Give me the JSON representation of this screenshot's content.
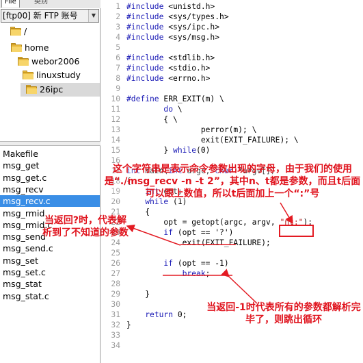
{
  "sidebar": {
    "tabs": [
      "File",
      "类别"
    ],
    "site_select": "[ftp00] 新 FTP 账号",
    "tree": [
      {
        "label": "/"
      },
      {
        "label": "home"
      },
      {
        "label": "webor2006"
      },
      {
        "label": "linuxstudy"
      },
      {
        "label": "26ipc",
        "selected": true
      }
    ],
    "files": [
      "Makefile",
      "msg_get",
      "msg_get.c",
      "msg_recv",
      "msg_recv.c",
      "msg_rmid",
      "msg_rmid.c",
      "msg_send",
      "msg_send.c",
      "msg_set",
      "msg_set.c",
      "msg_stat",
      "msg_stat.c"
    ],
    "selected_file": "msg_recv.c"
  },
  "editor": {
    "lines": [
      {
        "n": "1",
        "t": "#include <unistd.h>"
      },
      {
        "n": "2",
        "t": "#include <sys/types.h>"
      },
      {
        "n": "3",
        "t": "#include <sys/ipc.h>"
      },
      {
        "n": "4",
        "t": "#include <sys/msg.h>"
      },
      {
        "n": "5",
        "t": ""
      },
      {
        "n": "6",
        "t": "#include <stdlib.h>"
      },
      {
        "n": "7",
        "t": "#include <stdio.h>"
      },
      {
        "n": "8",
        "t": "#include <errno.h>"
      },
      {
        "n": "9",
        "t": ""
      },
      {
        "n": "10",
        "t": "#define ERR_EXIT(m) \\"
      },
      {
        "n": "11",
        "t": "        do \\"
      },
      {
        "n": "12",
        "t": "        { \\"
      },
      {
        "n": "13",
        "t": "                perror(m); \\"
      },
      {
        "n": "14",
        "t": "                exit(EXIT_FAILURE); \\"
      },
      {
        "n": "15",
        "t": "        } while(0)"
      },
      {
        "n": "16",
        "t": ""
      },
      {
        "n": "17",
        "t": "int main(int argc, char *argv[])"
      },
      {
        "n": "18",
        "t": "{"
      },
      {
        "n": "19",
        "t": "    int opt;"
      },
      {
        "n": "20",
        "t": "    while (1)"
      },
      {
        "n": "21",
        "t": "    {"
      },
      {
        "n": "22",
        "t": "        opt = getopt(argc, argv, \"nt:\");"
      },
      {
        "n": "23",
        "t": "        if (opt == '?')"
      },
      {
        "n": "24",
        "t": "            exit(EXIT_FAILURE);"
      },
      {
        "n": "25",
        "t": ""
      },
      {
        "n": "26",
        "t": "        if (opt == -1)"
      },
      {
        "n": "27",
        "t": "            break;"
      },
      {
        "n": "28",
        "t": ""
      },
      {
        "n": "29",
        "t": "    }"
      },
      {
        "n": "30",
        "t": ""
      },
      {
        "n": "31",
        "t": "    return 0;"
      },
      {
        "n": "32",
        "t": "}"
      },
      {
        "n": "33",
        "t": ""
      },
      {
        "n": "34",
        "t": ""
      }
    ]
  },
  "annotations": {
    "a1": "这个字符串是表示命令参数出现的字母，由于我们的使用是“./msg_recv -n -t 2”，其中n、t都是参数，而且t后面可以跟上数值，所以t后面加上一个“:”号",
    "a2": "当返回?时，代表解析到了不知道的参数",
    "a3": "当返回-1时代表所有的参数都解析完毕了，则跳出循环"
  },
  "colors": {
    "keyword": "#1818b5",
    "string": "#b01c1c",
    "annotation": "#e0141e",
    "selection": "#3a8ee6"
  }
}
